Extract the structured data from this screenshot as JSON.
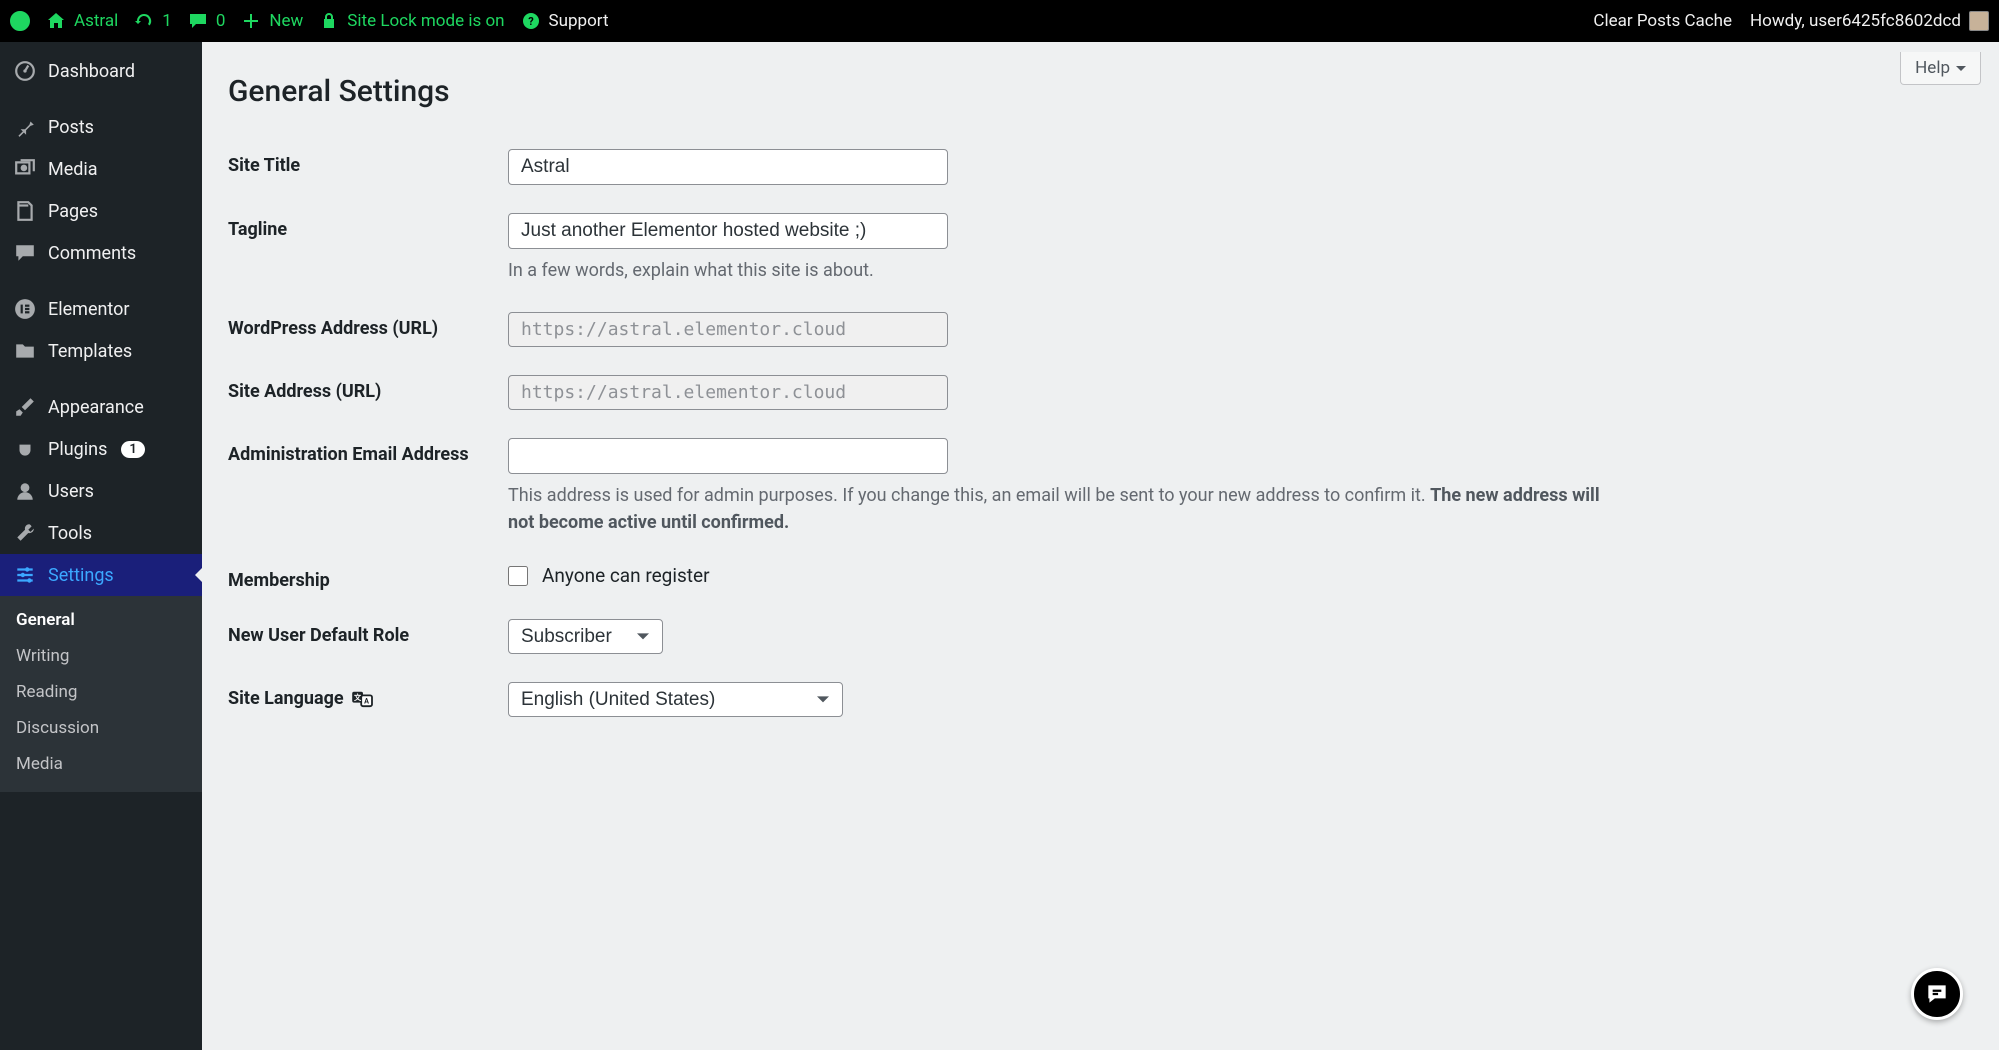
{
  "adminbar": {
    "site_name": "Astral",
    "update_count": "1",
    "comment_count": "0",
    "new_label": "New",
    "sitelock_label": "Site Lock mode is on",
    "support_label": "Support",
    "clear_cache": "Clear Posts Cache",
    "howdy": "Howdy, user6425fc8602dcd"
  },
  "sidebar": {
    "dashboard": "Dashboard",
    "posts": "Posts",
    "media": "Media",
    "pages": "Pages",
    "comments": "Comments",
    "elementor": "Elementor",
    "templates": "Templates",
    "appearance": "Appearance",
    "plugins": "Plugins",
    "plugins_count": "1",
    "users": "Users",
    "tools": "Tools",
    "settings": "Settings",
    "submenu": {
      "general": "General",
      "writing": "Writing",
      "reading": "Reading",
      "discussion": "Discussion",
      "media": "Media"
    }
  },
  "content": {
    "help": "Help",
    "title": "General Settings",
    "fields": {
      "site_title_label": "Site Title",
      "site_title_value": "Astral",
      "tagline_label": "Tagline",
      "tagline_value": "Just another Elementor hosted website ;)",
      "tagline_desc": "In a few words, explain what this site is about.",
      "wpurl_label": "WordPress Address (URL)",
      "wpurl_value": "https://astral.elementor.cloud",
      "siteurl_label": "Site Address (URL)",
      "siteurl_value": "https://astral.elementor.cloud",
      "admin_email_label": "Administration Email Address",
      "admin_email_value": "",
      "admin_email_desc_1": "This address is used for admin purposes. If you change this, an email will be sent to your new address to confirm it. ",
      "admin_email_desc_2": "The new address will not become active until confirmed.",
      "membership_label": "Membership",
      "membership_checkbox": "Anyone can register",
      "default_role_label": "New User Default Role",
      "default_role_value": "Subscriber",
      "language_label": "Site Language",
      "language_value": "English (United States)"
    }
  }
}
